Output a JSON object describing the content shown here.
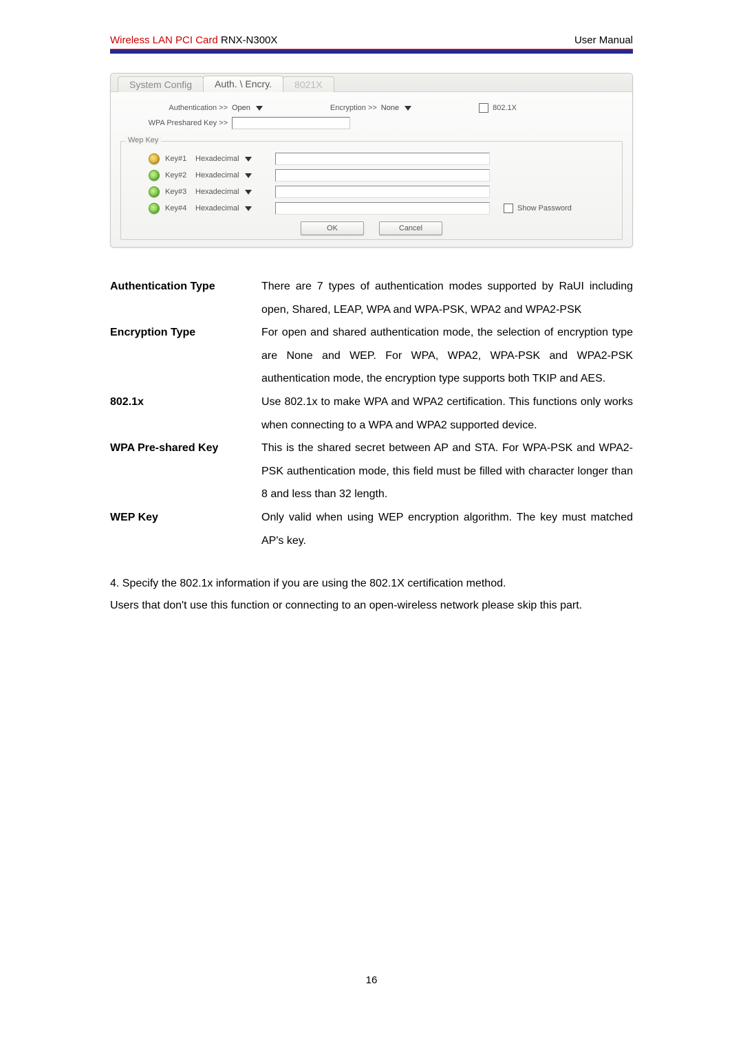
{
  "header": {
    "product_line": "Wireless LAN PCI Card",
    "model": "RNX-N300X",
    "right": "User Manual"
  },
  "panel": {
    "tabs": [
      "System Config",
      "Auth. \\ Encry.",
      "8021X"
    ],
    "active_tab_index": 1,
    "auth_label": "Authentication >>",
    "auth_value": "Open",
    "enc_label": "Encryption >>",
    "enc_value": "None",
    "chk_8021x_label": "802.1X",
    "wpa_label": "WPA Preshared Key >>",
    "wpa_value": "",
    "wep_legend": "Wep Key",
    "keys": [
      {
        "selected": true,
        "label": "Key#1",
        "fmt": "Hexadecimal",
        "value": ""
      },
      {
        "selected": false,
        "label": "Key#2",
        "fmt": "Hexadecimal",
        "value": ""
      },
      {
        "selected": false,
        "label": "Key#3",
        "fmt": "Hexadecimal",
        "value": ""
      },
      {
        "selected": false,
        "label": "Key#4",
        "fmt": "Hexadecimal",
        "value": ""
      }
    ],
    "show_password_label": "Show Password",
    "ok_label": "OK",
    "cancel_label": "Cancel"
  },
  "definitions": [
    {
      "term": "Authentication Type",
      "desc": "There are 7 types of authentication modes supported by RaUI including open, Shared, LEAP, WPA and WPA-PSK, WPA2 and WPA2-PSK"
    },
    {
      "term": "Encryption Type",
      "desc": "For open and shared authentication mode, the selection of encryption type are None and WEP. For WPA, WPA2, WPA-PSK and WPA2-PSK authentication mode, the encryption type supports both TKIP and AES."
    },
    {
      "term": "802.1x",
      "desc": "Use 802.1x to make WPA and WPA2 certification. This functions only works when connecting to a WPA and WPA2 supported device."
    },
    {
      "term": "WPA Pre-shared Key",
      "desc": "This is the shared secret between AP and STA. For WPA-PSK and WPA2-PSK authentication mode, this field must be filled with character longer than 8 and less than 32 length."
    },
    {
      "term": "WEP Key",
      "desc": "Only valid when using WEP encryption algorithm. The key must matched AP's key."
    }
  ],
  "body_paragraphs": [
    "4. Specify the 802.1x information if you are using the 802.1X certification method.",
    "Users that don't use this function or connecting to an open-wireless network please skip this part."
  ],
  "page_number": "16"
}
